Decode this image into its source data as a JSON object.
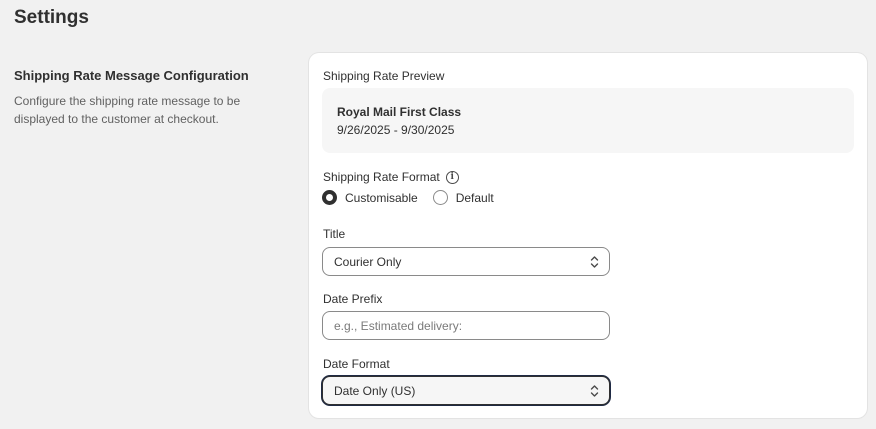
{
  "page": {
    "title": "Settings"
  },
  "section": {
    "heading": "Shipping Rate Message Configuration",
    "description": "Configure the shipping rate message to be displayed to the customer at checkout."
  },
  "preview": {
    "label": "Shipping Rate Preview",
    "rate_title": "Royal Mail First Class",
    "rate_dates": "9/26/2025 - 9/30/2025"
  },
  "format": {
    "label": "Shipping Rate Format",
    "info_icon": "info-icon",
    "options": [
      {
        "label": "Customisable",
        "selected": true
      },
      {
        "label": "Default",
        "selected": false
      }
    ]
  },
  "title_field": {
    "label": "Title",
    "value": "Courier Only"
  },
  "date_prefix": {
    "label": "Date Prefix",
    "value": "",
    "placeholder": "e.g., Estimated delivery:"
  },
  "date_format": {
    "label": "Date Format",
    "value": "Date Only (US)"
  }
}
